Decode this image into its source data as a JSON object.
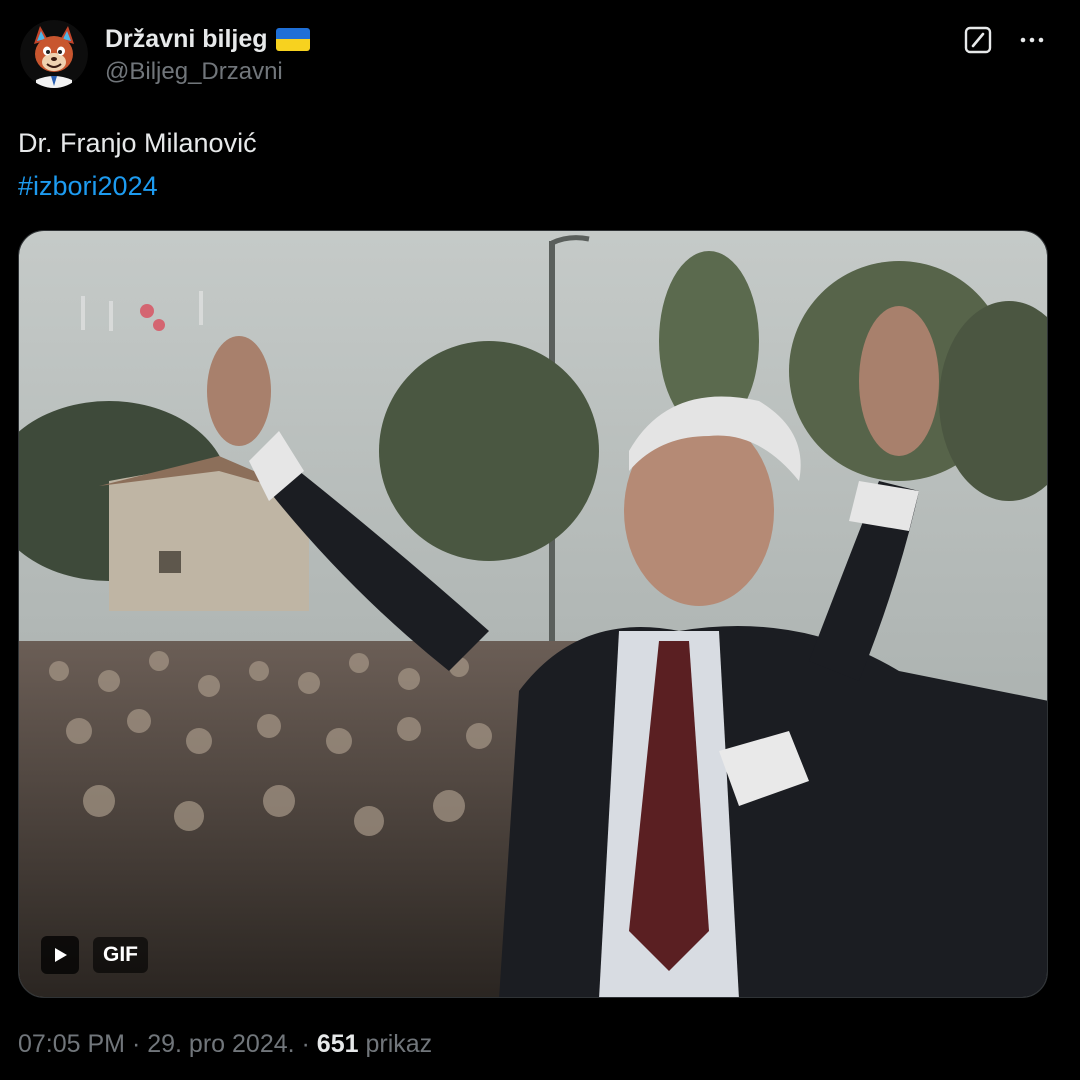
{
  "author": {
    "display_name": "Državni biljeg",
    "handle": "@Biljeg_Drzavni",
    "flag_icon": "ukraine-flag-icon",
    "flag_colors": [
      "#1f6fd6",
      "#f7d21f"
    ]
  },
  "top_icons": {
    "grok": "grok-icon",
    "more": "more-options-icon"
  },
  "tweet": {
    "line1": "Dr. Franjo Milanović",
    "hashtag": "#izbori2024"
  },
  "media": {
    "gif_label": "GIF",
    "play_icon": "play-icon"
  },
  "meta": {
    "time": "07:05 PM",
    "sep1": " · ",
    "date": "29. pro 2024.",
    "sep2": " · ",
    "views": "651",
    "views_label": " prikaz"
  },
  "colors": {
    "background": "#000000",
    "text": "#e7e9ea",
    "secondary": "#71767b",
    "link": "#1d9bf0"
  }
}
